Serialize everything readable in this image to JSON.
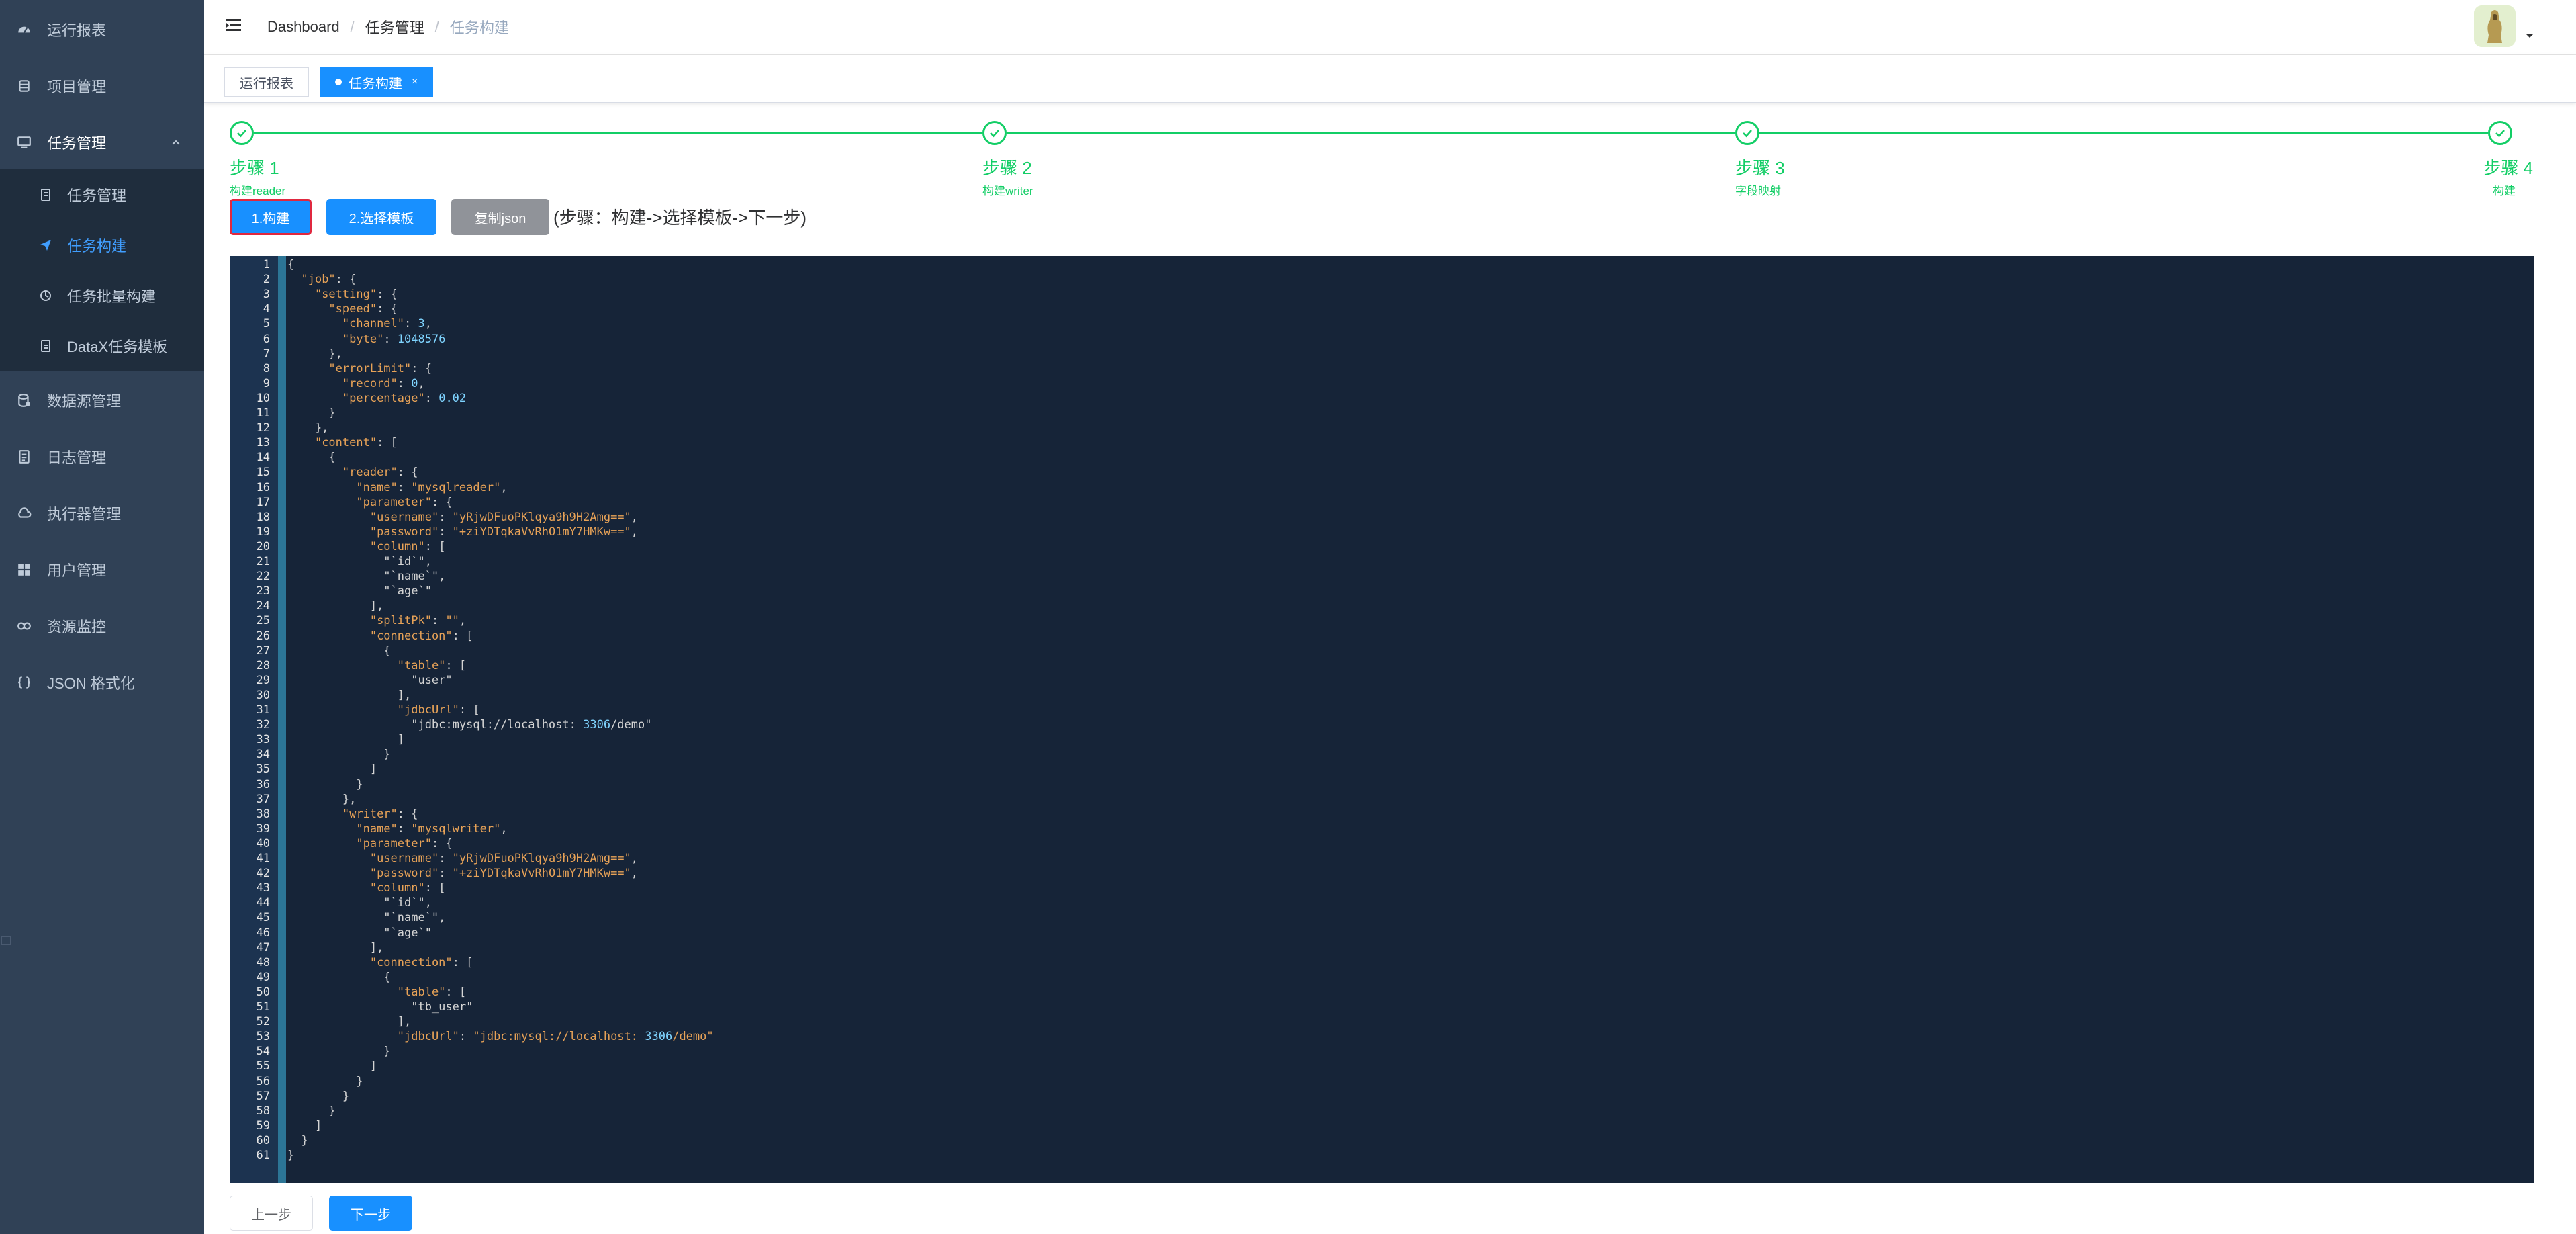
{
  "sidebar": {
    "items": [
      {
        "label": "运行报表",
        "icon": "dashboard-icon"
      },
      {
        "label": "项目管理",
        "icon": "database-icon"
      },
      {
        "label": "任务管理",
        "icon": "monitor-icon"
      },
      {
        "label": "数据源管理",
        "icon": "datasource-icon"
      },
      {
        "label": "日志管理",
        "icon": "document-icon"
      },
      {
        "label": "执行器管理",
        "icon": "cloud-icon"
      },
      {
        "label": "用户管理",
        "icon": "table-icon"
      },
      {
        "label": "资源监控",
        "icon": "eye-icon"
      },
      {
        "label": "JSON 格式化",
        "icon": "json-icon"
      }
    ],
    "submenu": [
      {
        "label": "任务管理",
        "icon": "list-icon"
      },
      {
        "label": "任务构建",
        "icon": "send-icon"
      },
      {
        "label": "任务批量构建",
        "icon": "batch-icon"
      },
      {
        "label": "DataX任务模板",
        "icon": "template-icon"
      }
    ]
  },
  "breadcrumb": [
    "Dashboard",
    "任务管理",
    "任务构建"
  ],
  "tags": [
    {
      "label": "运行报表"
    },
    {
      "label": "任务构建",
      "close": "×"
    }
  ],
  "steps": [
    {
      "title": "步骤 1",
      "desc": "构建reader"
    },
    {
      "title": "步骤 2",
      "desc": "构建writer"
    },
    {
      "title": "步骤 3",
      "desc": "字段映射"
    },
    {
      "title": "步骤 4",
      "desc": "构建"
    }
  ],
  "toolbar": {
    "build_label": "1.构建",
    "template_label": "2.选择模板",
    "copy_label": "复制json",
    "hint": "(步骤：构建->选择模板->下一步)"
  },
  "footer": {
    "prev_label": "上一步",
    "next_label": "下一步"
  },
  "colors": {
    "sidebar_bg": "#304156",
    "accent": "#1890ff",
    "success": "#13ce66",
    "editor_bg": "#162438"
  },
  "code_lines": [
    "{",
    "  \"job\": {",
    "    \"setting\": {",
    "      \"speed\": {",
    "        \"channel\": 3,",
    "        \"byte\": 1048576",
    "      },",
    "      \"errorLimit\": {",
    "        \"record\": 0,",
    "        \"percentage\": 0.02",
    "      }",
    "    },",
    "    \"content\": [",
    "      {",
    "        \"reader\": {",
    "          \"name\": \"mysqlreader\",",
    "          \"parameter\": {",
    "            \"username\": \"yRjwDFuoPKlqya9h9H2Amg==\",",
    "            \"password\": \"+ziYDTqkaVvRhO1mY7HMKw==\",",
    "            \"column\": [",
    "              \"`id`\",",
    "              \"`name`\",",
    "              \"`age`\"",
    "            ],",
    "            \"splitPk\": \"\",",
    "            \"connection\": [",
    "              {",
    "                \"table\": [",
    "                  \"user\"",
    "                ],",
    "                \"jdbcUrl\": [",
    "                  \"jdbc:mysql://localhost:3306/demo\"",
    "                ]",
    "              }",
    "            ]",
    "          }",
    "        },",
    "        \"writer\": {",
    "          \"name\": \"mysqlwriter\",",
    "          \"parameter\": {",
    "            \"username\": \"yRjwDFuoPKlqya9h9H2Amg==\",",
    "            \"password\": \"+ziYDTqkaVvRhO1mY7HMKw==\",",
    "            \"column\": [",
    "              \"`id`\",",
    "              \"`name`\",",
    "              \"`age`\"",
    "            ],",
    "            \"connection\": [",
    "              {",
    "                \"table\": [",
    "                  \"tb_user\"",
    "                ],",
    "                \"jdbcUrl\": \"jdbc:mysql://localhost:3306/demo\"",
    "              }",
    "            ]",
    "          }",
    "        }",
    "      }",
    "    ]",
    "  }",
    "}"
  ]
}
